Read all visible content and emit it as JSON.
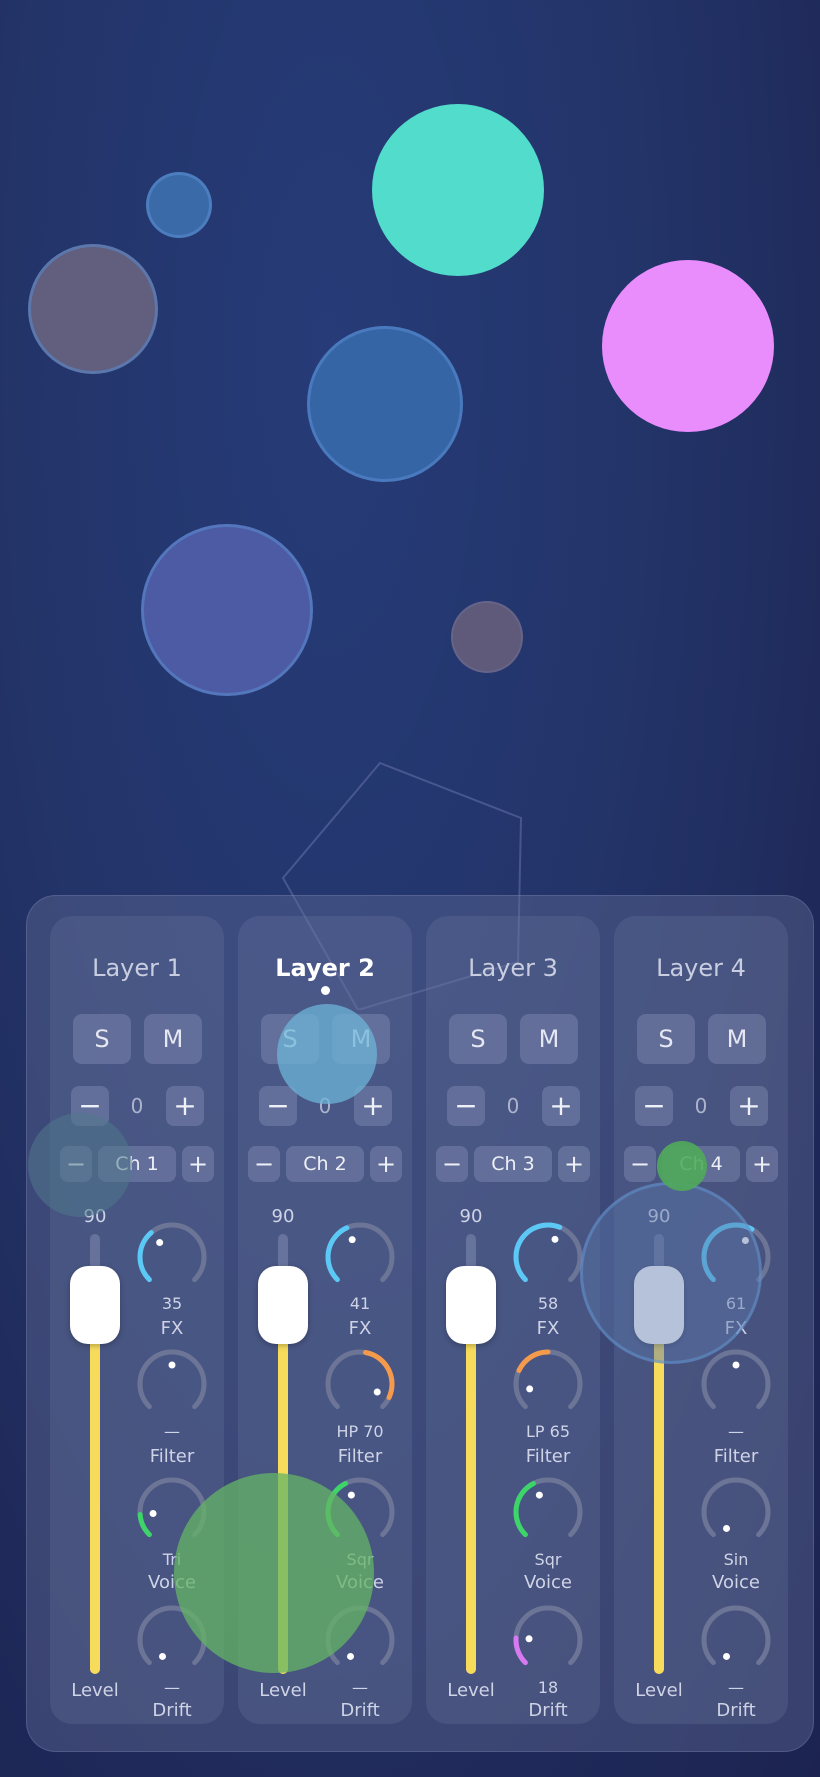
{
  "accent_color": "#f7dc5c",
  "knob_colors": {
    "fx": "#5cc8f5",
    "filter": "#f59a4a",
    "voice": "#3dd46a",
    "drift": "#d77af2",
    "track": "#6d7597"
  },
  "channels": [
    {
      "title": "Layer 1",
      "active": false,
      "solo": "S",
      "mute": "M",
      "minus": "−",
      "plus": "+",
      "offset": "0",
      "channel": "Ch 1",
      "level": "90",
      "level_fraction": 0.9,
      "level_label": "Level",
      "fx": {
        "value": "35",
        "label": "FX",
        "fraction": 0.35
      },
      "filter": {
        "value": "—",
        "label": "Filter",
        "fraction": 0,
        "mode": "none"
      },
      "voice": {
        "value": "Tri",
        "label": "Voice",
        "fraction": 0.15
      },
      "drift": {
        "value": "—",
        "label": "Drift",
        "fraction": 0
      }
    },
    {
      "title": "Layer 2",
      "active": true,
      "solo": "S",
      "mute": "M",
      "minus": "−",
      "plus": "+",
      "offset": "0",
      "channel": "Ch 2",
      "level": "90",
      "level_fraction": 0.9,
      "level_label": "Level",
      "fx": {
        "value": "41",
        "label": "FX",
        "fraction": 0.41
      },
      "filter": {
        "value": "HP 70",
        "label": "Filter",
        "fraction": 0.7,
        "mode": "hp"
      },
      "voice": {
        "value": "Sqr",
        "label": "Voice",
        "fraction": 0.4
      },
      "drift": {
        "value": "—",
        "label": "Drift",
        "fraction": 0
      }
    },
    {
      "title": "Layer 3",
      "active": false,
      "solo": "S",
      "mute": "M",
      "minus": "−",
      "plus": "+",
      "offset": "0",
      "channel": "Ch 3",
      "level": "90",
      "level_fraction": 0.9,
      "level_label": "Level",
      "fx": {
        "value": "58",
        "label": "FX",
        "fraction": 0.58
      },
      "filter": {
        "value": "LP 65",
        "label": "Filter",
        "fraction": 0.35,
        "mode": "lp"
      },
      "voice": {
        "value": "Sqr",
        "label": "Voice",
        "fraction": 0.4
      },
      "drift": {
        "value": "18",
        "label": "Drift",
        "fraction": 0.18
      }
    },
    {
      "title": "Layer 4",
      "active": false,
      "solo": "S",
      "mute": "M",
      "minus": "−",
      "plus": "+",
      "offset": "0",
      "channel": "Ch 4",
      "level": "90",
      "level_fraction": 0.9,
      "level_label": "Level",
      "fx": {
        "value": "61",
        "label": "FX",
        "fraction": 0.61
      },
      "filter": {
        "value": "—",
        "label": "Filter",
        "fraction": 0,
        "mode": "none"
      },
      "voice": {
        "value": "Sin",
        "label": "Voice",
        "fraction": 0
      },
      "drift": {
        "value": "—",
        "label": "Drift",
        "fraction": 0
      }
    }
  ]
}
